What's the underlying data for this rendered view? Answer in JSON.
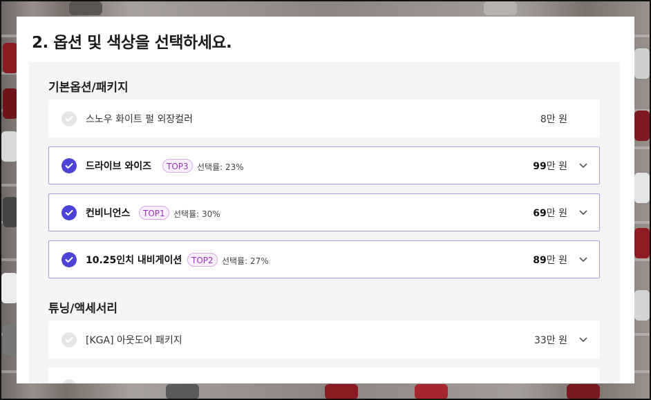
{
  "title": "2. 옵션 및 색상을 선택하세요.",
  "sections": [
    {
      "title": "기본옵션/패키지",
      "options": [
        {
          "name": "스노우 화이트 펄 외장컬러",
          "price_num": "8",
          "price_unit": "만 원",
          "selected": false
        },
        {
          "name": "드라이브 와이즈",
          "badge": "TOP3",
          "rate": "선택률: 23%",
          "price_num": "99",
          "price_unit": "만 원",
          "selected": true
        },
        {
          "name": "컨비니언스",
          "badge": "TOP1",
          "rate": "선택률: 30%",
          "price_num": "69",
          "price_unit": "만 원",
          "selected": true
        },
        {
          "name": "10.25인치 내비게이션",
          "badge": "TOP2",
          "rate": "선택률: 27%",
          "price_num": "89",
          "price_unit": "만 원",
          "selected": true
        }
      ]
    },
    {
      "title": "튜닝/액세서리",
      "options": [
        {
          "name": "[KGA] 아웃도어 패키지",
          "price_num": "33",
          "price_unit": "만 원",
          "selected": false
        }
      ]
    }
  ],
  "colors": {
    "accent": "#4b44d6",
    "badge_text": "#9b2fc0",
    "selected_border": "#9ea1e3"
  },
  "icons": {
    "check": "check-circle-icon",
    "expand": "chevron-down-icon"
  }
}
